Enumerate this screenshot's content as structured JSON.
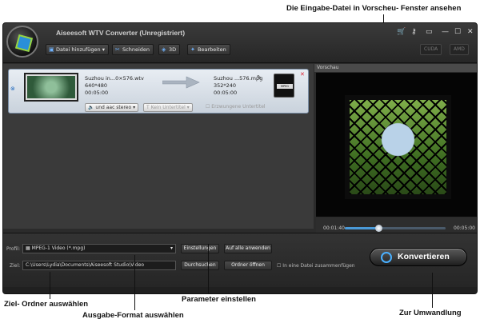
{
  "annotations": {
    "preview": "Die Eingabe-Datei in Vorscheu- Fenster ansehen",
    "target_folder": "Ziel- Ordner auswählen",
    "output_format": "Ausgabe-Format auswählen",
    "parameters": "Parameter einstellen",
    "convert": "Zur Umwandlung"
  },
  "app": {
    "title": "Aiseesoft WTV Converter (Unregistriert)"
  },
  "toolbar": {
    "add_file": "Datei hinzufügen",
    "cut": "Schneiden",
    "three_d": "3D",
    "edit": "Bearbeiten",
    "cuda": "CUDA",
    "amd": "AMD"
  },
  "file": {
    "source_name": "Suzhou in...0×576.wtv",
    "source_res": "640*480",
    "source_duration": "00:05:00",
    "target_name": "Suzhou ...576.mpg",
    "target_res": "352*240",
    "target_duration": "00:05:00",
    "audio_track": "und aac stereo",
    "subtitle": "Kein Untertitel",
    "forced_subtitle": "Erzwungene Untertitel",
    "device_label": "MPEG"
  },
  "preview": {
    "label": "Vorschau",
    "current_time": "00:01:40",
    "total_time": "00:05:00",
    "progress": 0.33,
    "volume": 0.85
  },
  "bottom": {
    "profile_label": "Profil:",
    "profile_value": "MPEG-1 Video (*.mpg)",
    "settings": "Einstellungen",
    "apply_all": "Auf alle anwenden",
    "target_label": "Ziel:",
    "target_path": "C:\\Users\\Lydia\\Documents\\Aiseesoft Studio\\Video",
    "browse": "Durchsuchen",
    "open_folder": "Ordner öffnen",
    "merge": "In eine Datei zusammenfügen",
    "convert": "Konvertieren"
  }
}
